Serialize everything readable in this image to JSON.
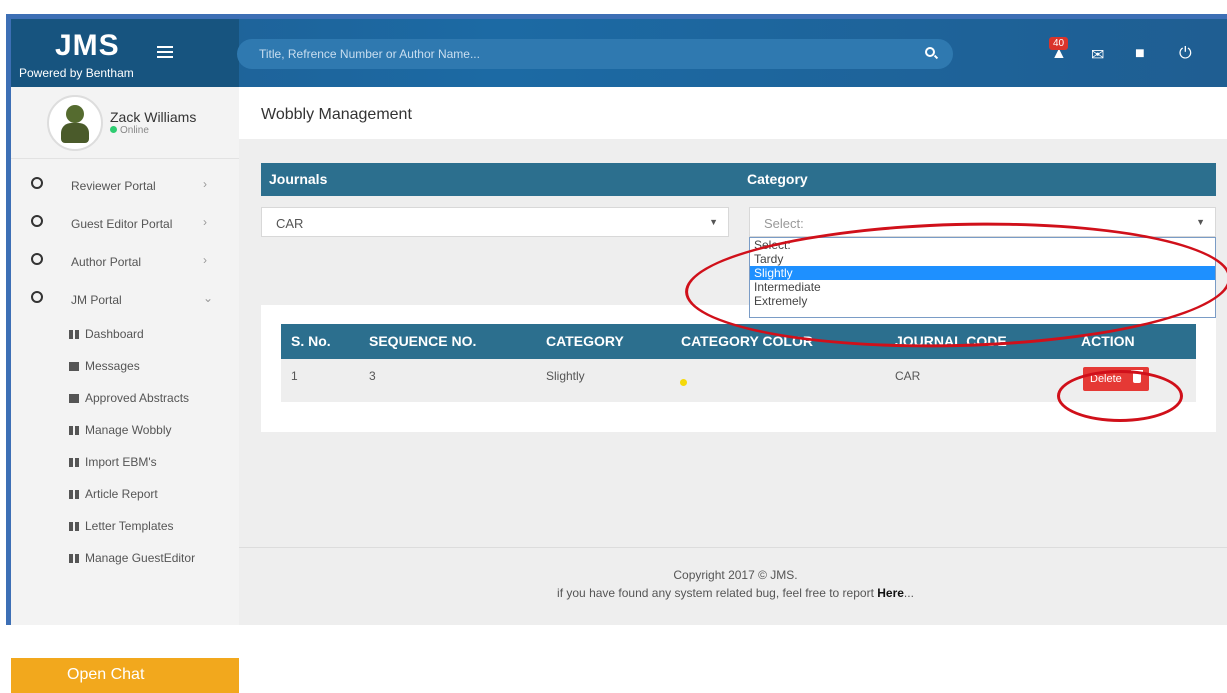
{
  "brand": {
    "title": "JMS",
    "subtitle": "Powered by Bentham"
  },
  "search": {
    "placeholder": "Title, Refrence Number or Author Name..."
  },
  "topbar": {
    "notification_count": "40"
  },
  "user": {
    "name": "Zack Williams",
    "status": "Online"
  },
  "sidebar": {
    "items": [
      {
        "label": "Reviewer Portal",
        "arrow": "›"
      },
      {
        "label": "Guest Editor Portal",
        "arrow": "›"
      },
      {
        "label": "Author Portal",
        "arrow": "›"
      },
      {
        "label": "JM Portal",
        "arrow": "⌄"
      }
    ],
    "subitems": [
      "Dashboard",
      "Messages",
      "Approved Abstracts",
      "Manage Wobbly",
      "Import EBM's",
      "Article Report",
      "Letter Templates",
      "Manage GuestEditor"
    ],
    "open_chat": "Open Chat"
  },
  "page": {
    "title": "Wobbly Management"
  },
  "filters": {
    "journals_label": "Journals",
    "category_label": "Category",
    "journal_value": "CAR",
    "category_value": "Select:",
    "category_options": [
      "Select:",
      "Tardy",
      "Slightly",
      "Intermediate",
      "Extremely"
    ],
    "category_selected": "Slightly"
  },
  "table": {
    "headers": [
      "S. No.",
      "SEQUENCE NO.",
      "CATEGORY",
      "CATEGORY COLOR",
      "JOURNAL CODE",
      "ACTION"
    ],
    "rows": [
      {
        "sno": "1",
        "sequence": "3",
        "category": "Slightly",
        "color": "#f5d90a",
        "journal_code": "CAR",
        "action": "Delete"
      }
    ]
  },
  "footer": {
    "copyright": "Copyright 2017 © JMS.",
    "bug_text": "if you have found any system related bug, feel free to report ",
    "here_link": "Here",
    "ellipsis": "..."
  },
  "colors": {
    "topbar": "#1b6aa3",
    "table_header": "#2c6f8e",
    "accent_orange": "#f2a81d",
    "delete_red": "#e53935",
    "annotation_red": "#d0101a"
  }
}
